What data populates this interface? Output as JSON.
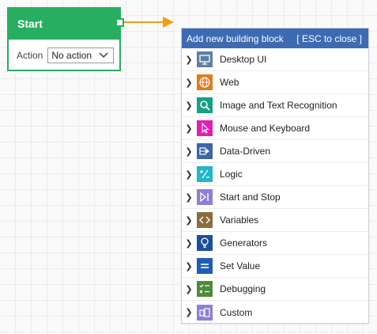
{
  "start_block": {
    "title": "Start",
    "action_label": "Action",
    "action_value": "No action",
    "accent": "#27ae60"
  },
  "connector_arrow_color": "#f39c12",
  "panel": {
    "title": "Add new building block",
    "close_hint": "[ ESC to close ]",
    "header_color": "#3d6bb3",
    "items": [
      {
        "label": "Desktop UI",
        "icon": "monitor-icon",
        "color": "#5f7fa0"
      },
      {
        "label": "Web",
        "icon": "globe-icon",
        "color": "#e07b18"
      },
      {
        "label": "Image and Text Recognition",
        "icon": "magnifier-icon",
        "color": "#16a085"
      },
      {
        "label": "Mouse and Keyboard",
        "icon": "cursor-icon",
        "color": "#e01fb0"
      },
      {
        "label": "Data-Driven",
        "icon": "data-driven-icon",
        "color": "#3b66a8"
      },
      {
        "label": "Logic",
        "icon": "plus-minus-icon",
        "color": "#1fb8c8"
      },
      {
        "label": "Start and Stop",
        "icon": "play-stop-icon",
        "color": "#8c7fd6"
      },
      {
        "label": "Variables",
        "icon": "code-brackets-icon",
        "color": "#8a6d3b"
      },
      {
        "label": "Generators",
        "icon": "lightbulb-icon",
        "color": "#1a4f9c"
      },
      {
        "label": "Set Value",
        "icon": "equals-icon",
        "color": "#1f5cb8"
      },
      {
        "label": "Debugging",
        "icon": "checklist-icon",
        "color": "#4f8a3a"
      },
      {
        "label": "Custom",
        "icon": "custom-blocks-icon",
        "color": "#8c7fd6"
      }
    ]
  }
}
